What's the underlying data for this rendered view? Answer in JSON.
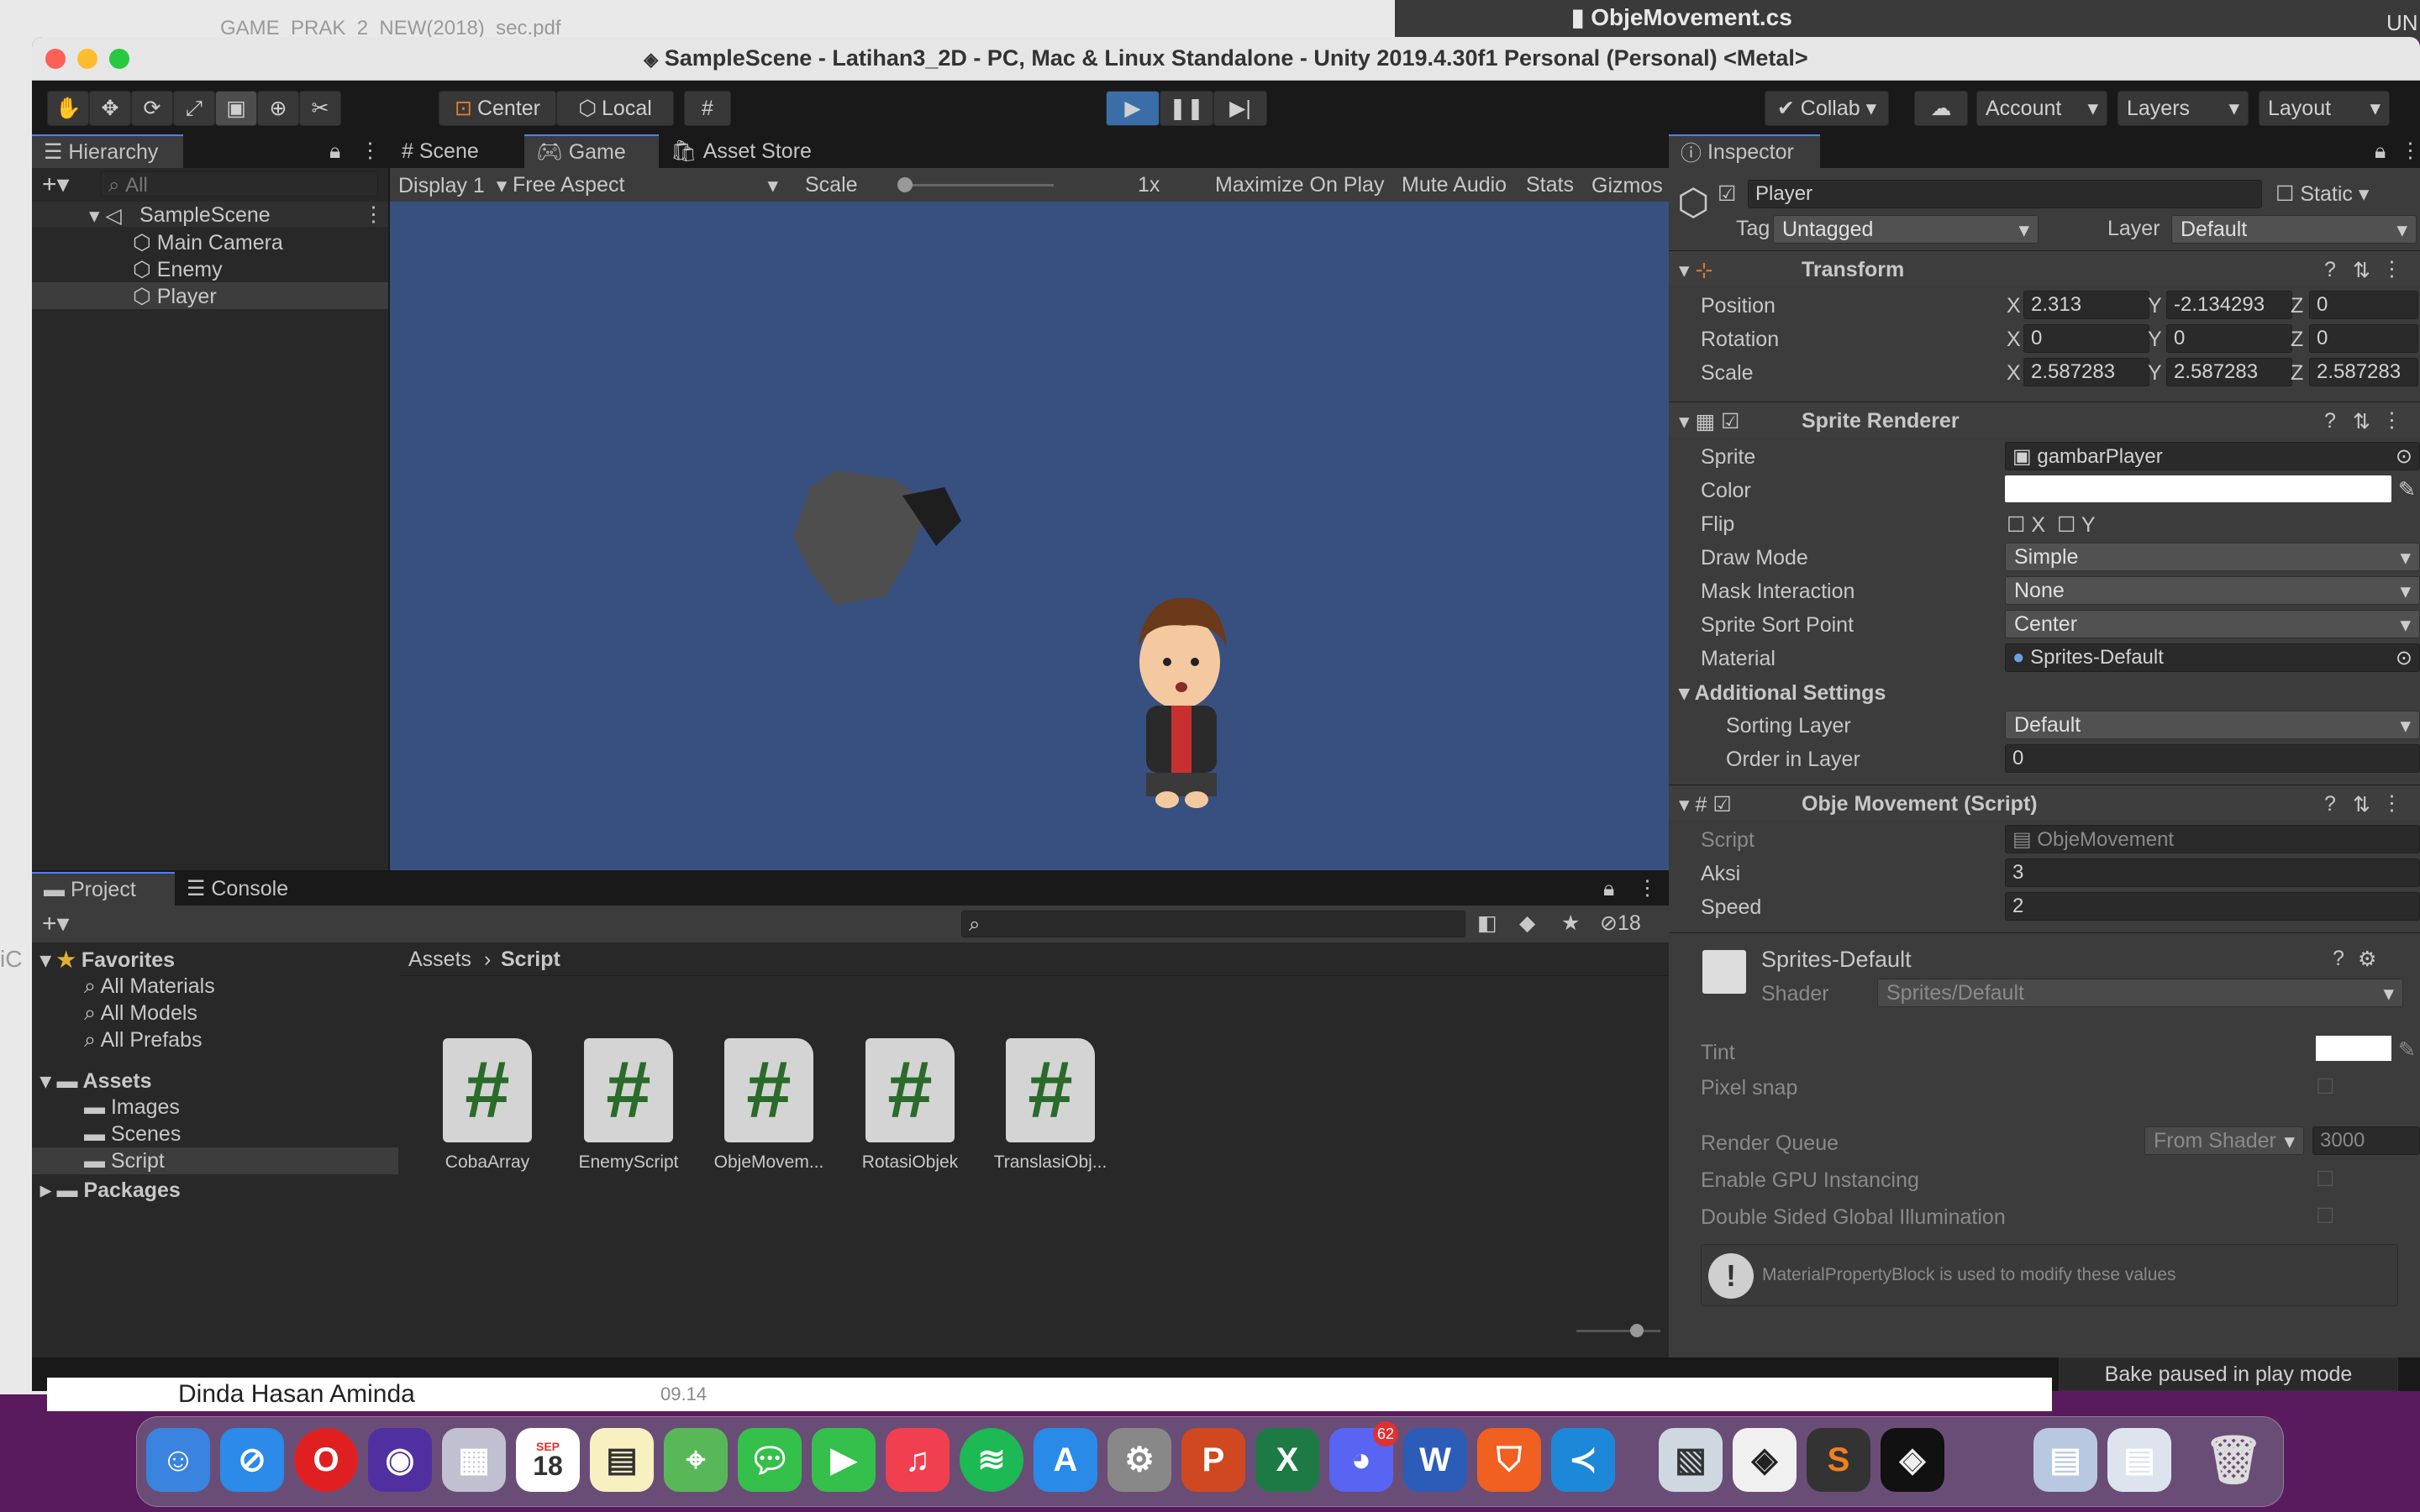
{
  "background": {
    "doc_title": "GAME_PRAK_2_NEW(2018)_sec.pdf",
    "other_file": "ObjeMovement.cs",
    "corner": "UN",
    "chat_name": "Dinda Hasan Aminda",
    "chat_time": "09.14",
    "side_text": "iC"
  },
  "window": {
    "title": "SampleScene - Latihan3_2D - PC, Mac & Linux Standalone - Unity 2019.4.30f1 Personal (Personal) <Metal>"
  },
  "toolbar": {
    "pivot": "Center",
    "space": "Local",
    "collab": "Collab",
    "account": "Account",
    "layers": "Layers",
    "layout": "Layout",
    "play_icon": "play-icon",
    "pause_icon": "pause-icon",
    "step_icon": "step-icon"
  },
  "hierarchy": {
    "tab": "Hierarchy",
    "search_placeholder": "All",
    "scene": "SampleScene",
    "items": [
      "Main Camera",
      "Enemy",
      "Player"
    ]
  },
  "center_tabs": {
    "scene": "Scene",
    "game": "Game",
    "store": "Asset Store"
  },
  "game_bar": {
    "display": "Display 1",
    "aspect": "Free Aspect",
    "scale_label": "Scale",
    "scale_value": "1x",
    "maximize": "Maximize On Play",
    "mute": "Mute Audio",
    "stats": "Stats",
    "gizmos": "Gizmos"
  },
  "inspector": {
    "tab": "Inspector",
    "object_name": "Player",
    "static_label": "Static",
    "tag_label": "Tag",
    "tag_value": "Untagged",
    "layer_label": "Layer",
    "layer_value": "Default",
    "transform": {
      "title": "Transform",
      "position_label": "Position",
      "rotation_label": "Rotation",
      "scale_label": "Scale",
      "position": {
        "x": "2.313",
        "y": "-2.134293",
        "z": "0"
      },
      "rotation": {
        "x": "0",
        "y": "0",
        "z": "0"
      },
      "scale": {
        "x": "2.587283",
        "y": "2.587283",
        "z": "2.587283"
      }
    },
    "sprite_renderer": {
      "title": "Sprite Renderer",
      "sprite_label": "Sprite",
      "sprite_value": "gambarPlayer",
      "color_label": "Color",
      "flip_label": "Flip",
      "flip_x": "X",
      "flip_y": "Y",
      "draw_mode_label": "Draw Mode",
      "draw_mode": "Simple",
      "mask_label": "Mask Interaction",
      "mask_value": "None",
      "sort_point_label": "Sprite Sort Point",
      "sort_point": "Center",
      "material_label": "Material",
      "material_value": "Sprites-Default",
      "additional": "Additional Settings",
      "sorting_layer_label": "Sorting Layer",
      "sorting_layer": "Default",
      "order_label": "Order in Layer",
      "order_value": "0"
    },
    "script": {
      "title": "Obje Movement (Script)",
      "script_label": "Script",
      "script_value": "ObjeMovement",
      "aksi_label": "Aksi",
      "aksi_value": "3",
      "speed_label": "Speed",
      "speed_value": "2"
    },
    "material": {
      "name": "Sprites-Default",
      "shader_label": "Shader",
      "shader_value": "Sprites/Default",
      "tint": "Tint",
      "pixel_snap": "Pixel snap",
      "render_queue": "Render Queue",
      "render_queue_mode": "From Shader",
      "render_queue_value": "3000",
      "gpu": "Enable GPU Instancing",
      "double_sided": "Double Sided Global Illumination",
      "note": "MaterialPropertyBlock is used to modify these values"
    }
  },
  "project": {
    "tab_project": "Project",
    "tab_console": "Console",
    "hidden_count": "18",
    "favorites": "Favorites",
    "fav_items": [
      "All Materials",
      "All Models",
      "All Prefabs"
    ],
    "assets": "Assets",
    "asset_folders": [
      "Images",
      "Scenes",
      "Script"
    ],
    "packages": "Packages",
    "breadcrumb_root": "Assets",
    "breadcrumb_current": "Script",
    "files": [
      "CobaArray",
      "EnemyScript",
      "ObjeMovem...",
      "RotasiObjek",
      "TranslasiObj..."
    ]
  },
  "status": {
    "message": "Bake paused in play mode"
  },
  "dock": {
    "calendar_month": "SEP",
    "calendar_day": "18",
    "discord_badge": "62"
  }
}
